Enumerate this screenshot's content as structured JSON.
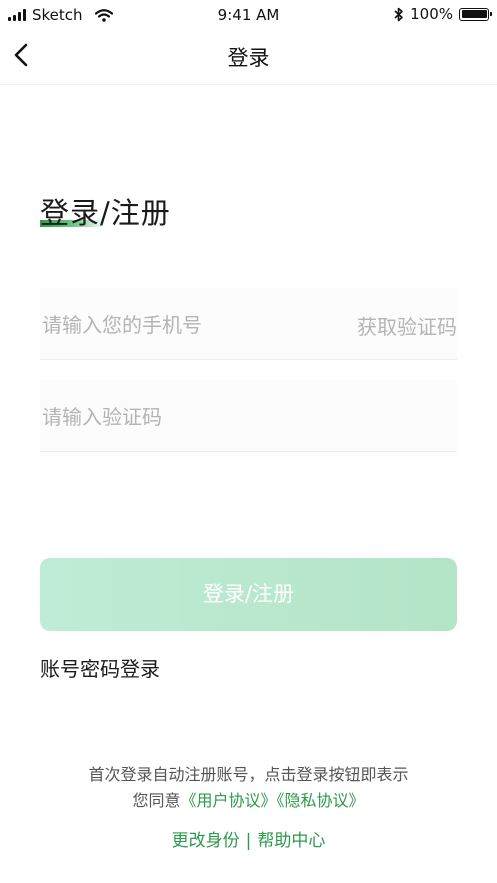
{
  "status_bar": {
    "carrier": "Sketch",
    "time": "9:41 AM",
    "battery": "100%",
    "icons": [
      "signal-icon",
      "wifi-icon",
      "bluetooth-icon",
      "battery-icon"
    ]
  },
  "nav": {
    "title": "登录",
    "back_icon": "chevron-left-icon"
  },
  "heading": "登录/注册",
  "phone": {
    "placeholder": "请输入您的手机号",
    "value": "",
    "get_code_label": "获取验证码"
  },
  "code": {
    "placeholder": "请输入验证码",
    "value": ""
  },
  "submit_label": "登录/注册",
  "password_login_label": "账号密码登录",
  "agreement": {
    "line1": "首次登录自动注册账号，点击登录按钮即表示",
    "prefix": "您同意",
    "user_agreement": "《用户协议》",
    "privacy_policy": "《隐私协议》"
  },
  "footer": {
    "change_identity": "更改身份",
    "separator": "|",
    "help_center": "帮助中心"
  },
  "colors": {
    "accent_green": "#2c9a4b",
    "button_bg": "#bfecd6",
    "placeholder": "#b4b4b4"
  }
}
